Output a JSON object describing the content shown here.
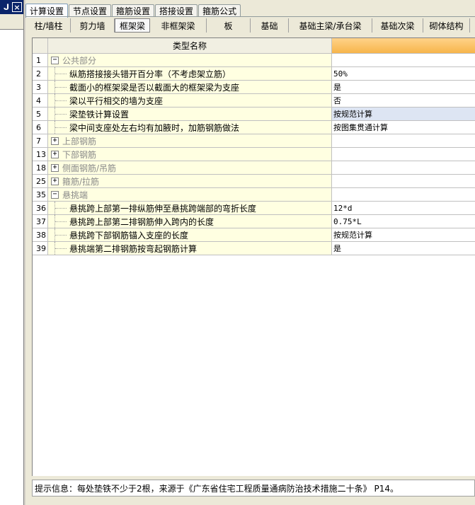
{
  "left_panel": {
    "pin_glyph": "ᒍ",
    "close_glyph": "×"
  },
  "top_tabs": [
    {
      "label": "计算设置",
      "active": true
    },
    {
      "label": "节点设置",
      "active": false
    },
    {
      "label": "箍筋设置",
      "active": false
    },
    {
      "label": "搭接设置",
      "active": false
    },
    {
      "label": "箍筋公式",
      "active": false
    }
  ],
  "sub_tabs": [
    {
      "label": "柱/墙柱",
      "active": false
    },
    {
      "label": "剪力墙",
      "active": false
    },
    {
      "label": "框架梁",
      "active": true
    },
    {
      "label": "非框架梁",
      "active": false
    },
    {
      "label": "板",
      "active": false
    },
    {
      "label": "基础",
      "active": false
    },
    {
      "label": "基础主梁/承台梁",
      "active": false
    },
    {
      "label": "基础次梁",
      "active": false
    },
    {
      "label": "砌体结构",
      "active": false
    }
  ],
  "grid": {
    "header_name": "类型名称",
    "rows": [
      {
        "num": "1",
        "kind": "group",
        "expander": "−",
        "name": "公共部分",
        "value": ""
      },
      {
        "num": "2",
        "kind": "item",
        "name": "纵筋搭接接头错开百分率（不考虑架立筋）",
        "value": "50%"
      },
      {
        "num": "3",
        "kind": "item",
        "name": "截面小的框架梁是否以截面大的框架梁为支座",
        "value": "是"
      },
      {
        "num": "4",
        "kind": "item",
        "name": "梁以平行相交的墙为支座",
        "value": "否"
      },
      {
        "num": "5",
        "kind": "item",
        "name": "梁垫铁计算设置",
        "value": "按规范计算",
        "highlight": true
      },
      {
        "num": "6",
        "kind": "item",
        "name": "梁中间支座处左右均有加腋时，加筋钢筋做法",
        "value": "按图集贯通计算"
      },
      {
        "num": "7",
        "kind": "group",
        "expander": "+",
        "name": "上部钢筋",
        "value": ""
      },
      {
        "num": "13",
        "kind": "group",
        "expander": "+",
        "name": "下部钢筋",
        "value": ""
      },
      {
        "num": "18",
        "kind": "group",
        "expander": "+",
        "name": "侧面钢筋/吊筋",
        "value": ""
      },
      {
        "num": "25",
        "kind": "group",
        "expander": "+",
        "name": "箍筋/拉筋",
        "value": ""
      },
      {
        "num": "35",
        "kind": "group",
        "expander": "−",
        "name": "悬挑端",
        "value": ""
      },
      {
        "num": "36",
        "kind": "item",
        "name": "悬挑跨上部第一排纵筋伸至悬挑跨端部的弯折长度",
        "value": "12*d"
      },
      {
        "num": "37",
        "kind": "item",
        "name": "悬挑跨上部第二排钢筋伸入跨内的长度",
        "value": "0.75*L"
      },
      {
        "num": "38",
        "kind": "item",
        "name": "悬挑跨下部钢筋锚入支座的长度",
        "value": "按规范计算"
      },
      {
        "num": "39",
        "kind": "item",
        "name": "悬挑端第二排钢筋按弯起钢筋计算",
        "value": "是"
      }
    ]
  },
  "status": {
    "text": "提示信息：每处垫铁不少于2根，来源于《广东省住宅工程质量通病防治技术措施二十条》 P14。"
  }
}
